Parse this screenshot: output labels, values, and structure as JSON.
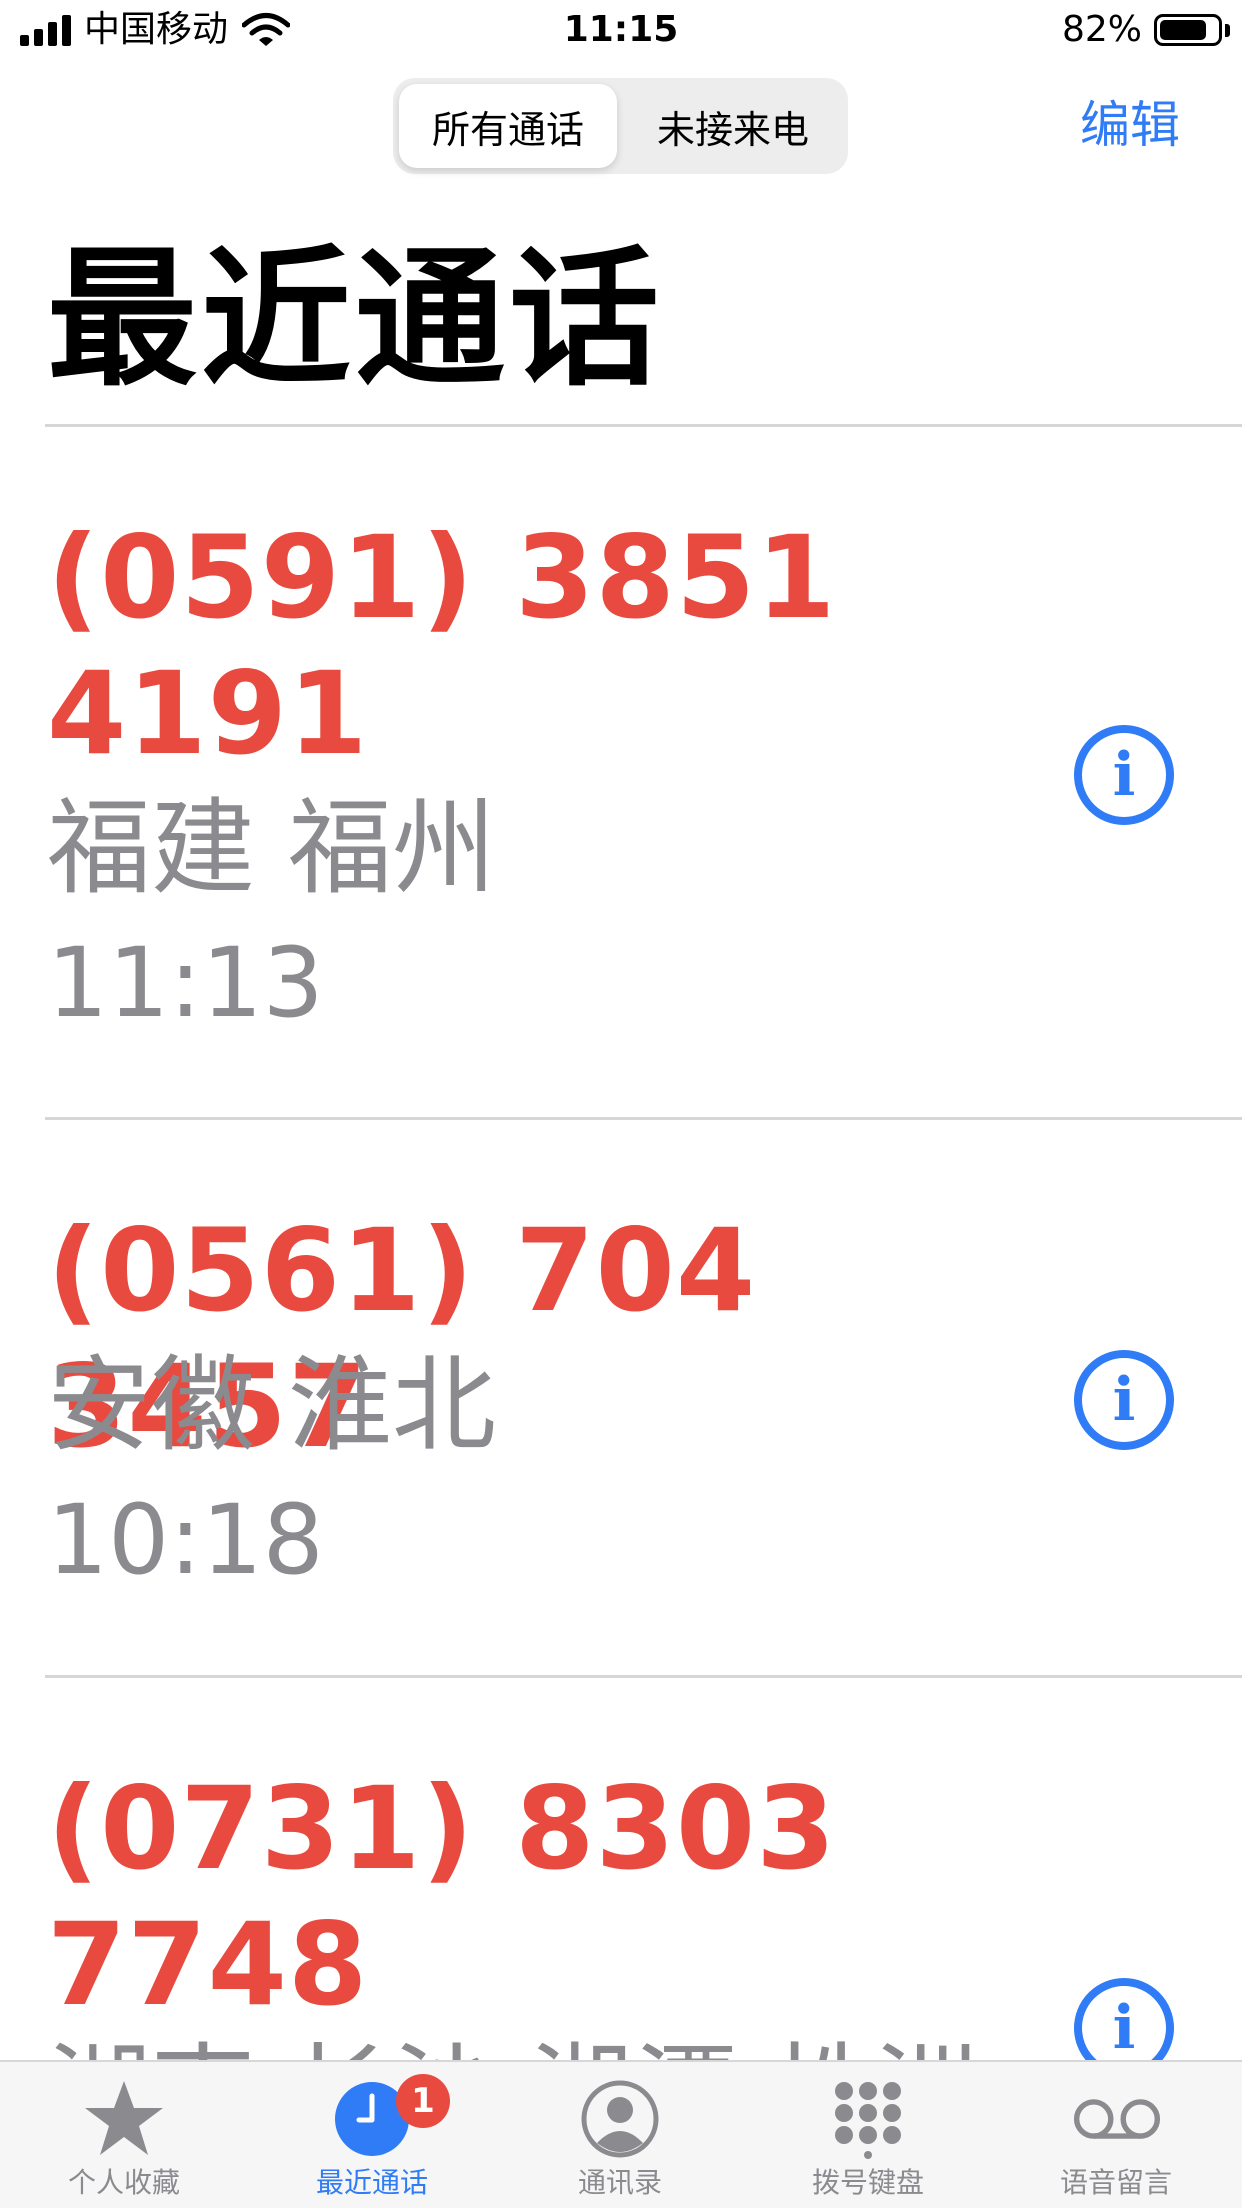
{
  "status_bar": {
    "carrier": "中国移动",
    "time": "11:15",
    "battery_percent": "82%",
    "battery_level": 0.82,
    "signal_icon": "cellular-signal-icon",
    "wifi_icon": "wifi-icon"
  },
  "nav": {
    "segments": [
      {
        "label": "所有通话",
        "selected": true
      },
      {
        "label": "未接来电",
        "selected": false
      }
    ],
    "edit_label": "编辑",
    "title": "最近通话"
  },
  "calls": [
    {
      "number_line1": "(0591) 3851",
      "number_line2": "4191",
      "location": "福建 福州",
      "time": "11:13"
    },
    {
      "number_line1": "(0561) 704 3457",
      "location": "安徽 淮北",
      "time": "10:18"
    },
    {
      "number_line1": "(0731) 8303",
      "number_line2": "7748",
      "location": "湖南 长沙 湘潭 株洲"
    }
  ],
  "info_glyph": "i",
  "tab_bar": {
    "items": [
      {
        "label": "个人收藏",
        "icon": "star-icon"
      },
      {
        "label": "最近通话",
        "icon": "clock-icon",
        "active": true,
        "badge": "1"
      },
      {
        "label": "通讯录",
        "icon": "person-circle-icon"
      },
      {
        "label": "拨号键盘",
        "icon": "keypad-icon"
      },
      {
        "label": "语音留言",
        "icon": "voicemail-icon"
      }
    ]
  },
  "colors": {
    "accent": "#2f7cf6",
    "missed_red": "#e84a3f",
    "secondary_text": "#8b8b8f"
  }
}
